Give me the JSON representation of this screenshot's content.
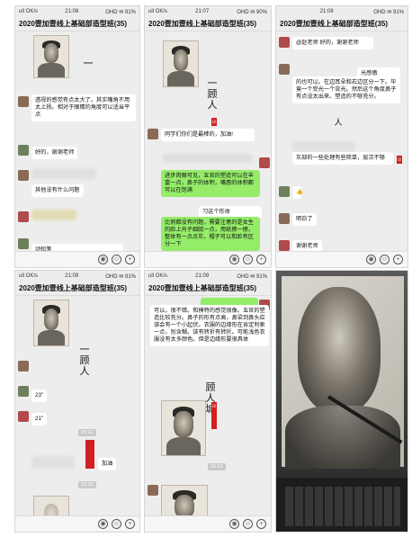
{
  "colors": {
    "chat_bg": "#ededed",
    "bubble": "#ffffff",
    "bubble_self": "#95ec69",
    "badge": "#d02020"
  },
  "group_title": "2020壹加壹线上基础部造型班(35)",
  "panels": [
    {
      "status": {
        "time": "21:08",
        "left": "ull OK/s",
        "right": "OHD ✉ 91%"
      },
      "title": "2020壹加壹线上基础部造型班(35)",
      "vertical_text": "",
      "messages": [
        "透视的感觉有点太大了。其实嘴角不用太上扬。相对于眼睛的角度可以适当平点",
        "好的，谢谢老师",
        "其他没有什么问题",
        "动铅笔"
      ],
      "icons": [
        "voice-icon",
        "emoji-icon",
        "add-icon"
      ]
    },
    {
      "status": {
        "time": "21:07",
        "left": "ull OK/s",
        "right": "OHD ✉ 90%"
      },
      "title": "2020壹加壹线上基础部造型班(35)",
      "vertical_text": "一顾人",
      "messages": [
        "同学们你们是最棒的，加油!",
        "进步肉眼可见，五官的塑造可以在丰富一点，鼻子的体积，嘴唇的体积都可以在饱满",
        "比例都没有问题，需要注意的是女生的脸上肖子细腻一点，用纸擦一擦，整体有一点点灰，帽子可以和脸有区分一下",
        "习这个形体"
      ],
      "icons": [
        "voice-icon",
        "emoji-icon",
        "add-icon"
      ]
    },
    {
      "status": {
        "time": "21:08",
        "left": "",
        "right": "OHD ✉ 91%"
      },
      "title": "2020壹加壹线上基础部造型班(35)",
      "vertical_text": "",
      "messages": [
        "@赵老师 好的，谢谢老师",
        "光感傲",
        "的也可以。在边耳朵和右边区分一下。毕竟一个受光一个背光。然后这个角度鼻子有点没太出来。塑造的不够充分。",
        "灰部的一些处理有些简单，层次不够",
        "明白了",
        "谢谢老师"
      ],
      "icons": [
        "voice-icon",
        "emoji-icon",
        "add-icon"
      ]
    },
    {
      "status": {
        "time": "21:09",
        "left": "ull OK/s",
        "right": "OHD ✉ 91%"
      },
      "title": "2020壹加壹线上基础部造型班(35)",
      "vertical_text": "一顾人城",
      "messages": [
        "23\"",
        "21\"",
        "加油"
      ],
      "timestamps": [
        "15:31",
        "15:35"
      ],
      "icons": [
        "voice-icon",
        "emoji-icon",
        "add-icon"
      ]
    },
    {
      "status": {
        "time": "21:09",
        "left": "ull OK/s",
        "right": "OHD ✉ 91%"
      },
      "title": "2020壹加壹线上基础部造型班(35)",
      "vertical_text": "顾人城",
      "messages": [
        "可以。很不错。和模特的感觉很像。五官的塑造比较充分。鼻子的形有点高，鼻梁到鼻头应该会有一个小起伏。衣服的边缘形在肯定利索一点，别含糊。该有转折有转折。可能浅色衣服没有太多颜色。但是边缘形要很具体"
      ],
      "timestamps": [
        "15:31"
      ],
      "icons": [
        "voice-icon",
        "emoji-icon",
        "add-icon"
      ]
    },
    {
      "status": {
        "time": "",
        "left": "",
        "right": ""
      },
      "title": "",
      "vertical_text": "",
      "messages": [],
      "icons": []
    }
  ]
}
